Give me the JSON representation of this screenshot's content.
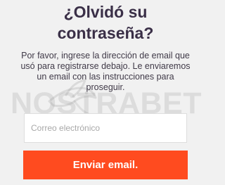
{
  "page": {
    "title_line_1": "¿Olvidó su",
    "title_line_2": "contraseña?",
    "description": "Por favor, ingrese la dirección de email que usó para registrarse debajo. Le enviaremos un email con las instrucciones para proseguir."
  },
  "watermark": {
    "text": "NOSTRABET",
    "icon": "bird-icon"
  },
  "form": {
    "email_placeholder": "Correo electrónico",
    "email_value": "",
    "submit_label": "Enviar email."
  },
  "colors": {
    "background": "#f1f1f1",
    "title": "#3a2f47",
    "text": "#403a48",
    "input_background": "#ffffff",
    "input_border": "#dedede",
    "placeholder": "#a8a8a8",
    "button_background": "#ff4b1f",
    "button_text": "#ffffff",
    "watermark": "#969696"
  }
}
